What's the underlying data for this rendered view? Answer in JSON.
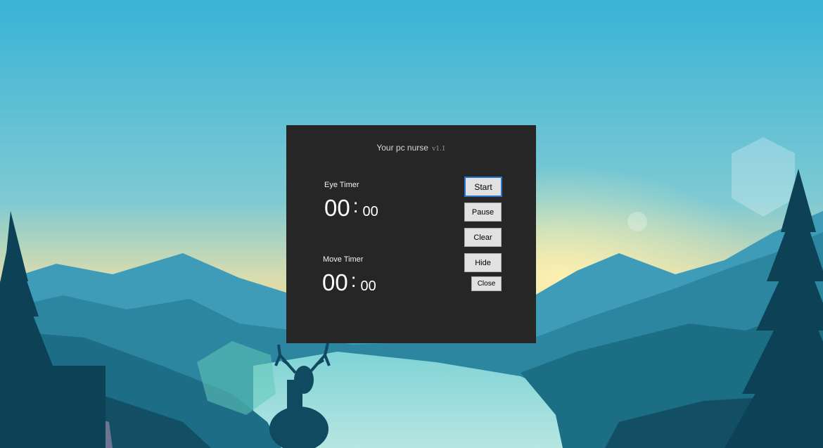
{
  "app": {
    "title": "Your pc nurse",
    "version": "v1.1"
  },
  "eye_timer": {
    "label": "Eye Timer",
    "minutes": "00",
    "separator": ":",
    "seconds": "00"
  },
  "move_timer": {
    "label": "Move Timer",
    "minutes": "00",
    "separator": ":",
    "seconds": "00"
  },
  "buttons": {
    "start": "Start",
    "pause": "Pause",
    "clear": "Clear",
    "hide": "Hide",
    "close": "Close"
  },
  "colors": {
    "window_bg": "#262626",
    "button_bg": "#e1e1e1",
    "focus_border": "#2a74d4"
  }
}
